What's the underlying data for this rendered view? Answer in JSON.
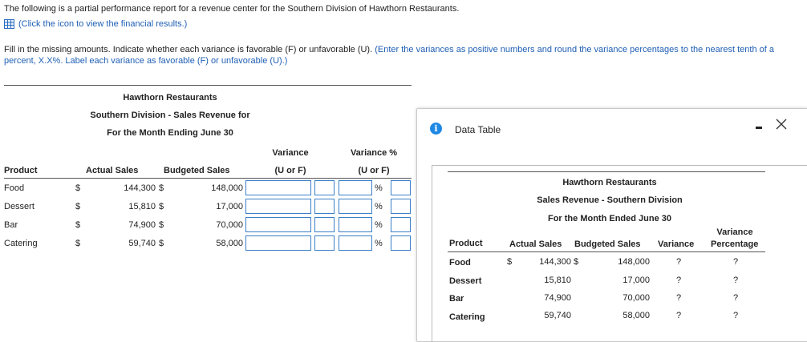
{
  "intro": "The following is a partial performance report for a revenue center for the Southern Division of Hawthorn Restaurants.",
  "icon_link": "(Click the icon to view the financial results.)",
  "instructions_plain": "Fill in the missing amounts. Indicate whether each variance is favorable (F) or unfavorable (U). ",
  "instructions_highlight": "(Enter the variances as positive numbers and round the variance percentages to the nearest tenth of a percent, X.X%. Label each variance as favorable (F) or unfavorable (U).)",
  "report": {
    "company": "Hawthorn Restaurants",
    "subtitle": "Southern Division - Sales Revenue for",
    "period": "For the Month Ending June 30",
    "header_variance": "Variance",
    "header_variance_pct": "Variance %",
    "headers": {
      "product": "Product",
      "actual": "Actual Sales",
      "budgeted": "Budgeted Sales",
      "uf": "(U or F)",
      "uf_pct": "(U or F)"
    },
    "currency": "$",
    "pct_sign": "%",
    "rows": [
      {
        "product": "Food",
        "actual": "144,300",
        "budgeted": "148,000"
      },
      {
        "product": "Dessert",
        "actual": "15,810",
        "budgeted": "17,000"
      },
      {
        "product": "Bar",
        "actual": "74,900",
        "budgeted": "70,000"
      },
      {
        "product": "Catering",
        "actual": "59,740",
        "budgeted": "58,000"
      }
    ]
  },
  "dialog": {
    "title": "Data Table",
    "minimize": "-",
    "close": "X",
    "company": "Hawthorn Restaurants",
    "subtitle": "Sales Revenue - Southern Division",
    "period": "For the Month Ended June 30",
    "headers": {
      "product": "Product",
      "actual": "Actual Sales",
      "budgeted": "Budgeted Sales",
      "variance": "Variance",
      "variance_top": "Variance",
      "percentage": "Percentage"
    },
    "currency": "$",
    "unknown": "?",
    "rows": [
      {
        "product": "Food",
        "actual": "144,300",
        "budgeted": "148,000"
      },
      {
        "product": "Dessert",
        "actual": "15,810",
        "budgeted": "17,000"
      },
      {
        "product": "Bar",
        "actual": "74,900",
        "budgeted": "70,000"
      },
      {
        "product": "Catering",
        "actual": "59,740",
        "budgeted": "58,000"
      }
    ]
  }
}
